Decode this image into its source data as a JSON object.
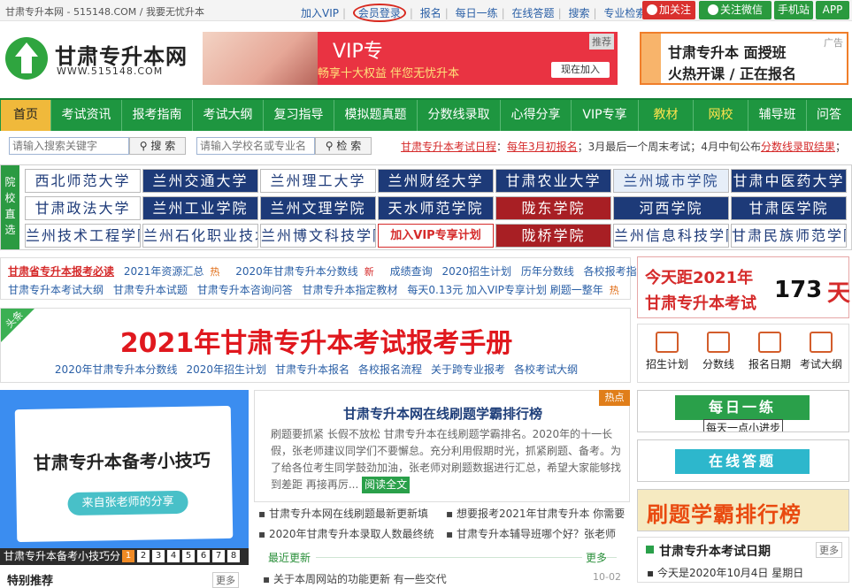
{
  "topbar": {
    "site": "甘肃专升本网 - 515148.COM / 我要无忧升本",
    "links": [
      "加入VIP",
      "会员登录",
      "报名",
      "每日一练",
      "在线答题",
      "搜索",
      "专业检索"
    ],
    "weibo": "加关注",
    "wechat": "关注微信",
    "mobile": "手机站",
    "app": "APP"
  },
  "logo": {
    "title": "甘肃专升本网",
    "url": "WWW.515148.COM"
  },
  "vip_banner": {
    "title": "VIP专",
    "subtitle": "畅享十大权益 伴您无忧升本",
    "tag": "推荐",
    "button": "现在加入"
  },
  "ad_right": {
    "line1": "甘肃专升本 面授班",
    "line2": "火热开课 / 正在报名",
    "tag": "广告"
  },
  "nav": [
    "首页",
    "考试资讯",
    "报考指南",
    "考试大纲",
    "复习指导",
    "模拟题真题",
    "分数线录取",
    "心得分享",
    "VIP专享",
    "教材",
    "网校",
    "辅导班",
    "问答"
  ],
  "search": {
    "keyword_placeholder": "请输入搜索关键字",
    "keyword_button": "搜 索",
    "school_placeholder": "请输入学校名或专业名",
    "school_button": "检 索"
  },
  "exam_info": {
    "schedule_link": "甘肃专升本考试日程",
    "sep": "：",
    "date_link": "每年3月初报名",
    "middle": "；3月最后一个周末考试；4月中旬公布",
    "result_link": "分数线录取结果",
    "end": "；"
  },
  "schools": {
    "side_label": "院校直选",
    "items": [
      "西北师范大学",
      "兰州交通大学",
      "兰州理工大学",
      "兰州财经大学",
      "甘肃农业大学",
      "兰州城市学院",
      "甘肃中医药大学",
      "甘肃政法大学",
      "兰州工业学院",
      "兰州文理学院",
      "天水师范学院",
      "陇东学院",
      "河西学院",
      "甘肃医学院",
      "兰州技术工程学院",
      "兰州石化职业技术大学",
      "兰州博文科技学院",
      "加入VIP专享计划",
      "陇桥学院",
      "兰州信息科技学院",
      "甘肃民族师范学院"
    ]
  },
  "links": {
    "row1": [
      "甘肃省专升本报考必读",
      "2021年资源汇总",
      "热",
      "2020年甘肃专升本分数线",
      "新",
      "成绩查询",
      "2020招生计划",
      "历年分数线",
      "各校报考指南"
    ],
    "row2": [
      "甘肃专升本考试大纲",
      "甘肃专升本试题",
      "甘肃专升本咨询问答",
      "甘肃专升本指定教材",
      "每天0.13元 加入VIP专享计划 刷题一整年",
      "热"
    ]
  },
  "countdown": {
    "line1": "今天距2021年",
    "line2": "甘肃专升本考试",
    "days": "173",
    "unit": "天"
  },
  "headline": {
    "corner": "头条",
    "title": "2021年甘肃专升本考试报考手册",
    "links": [
      "2020年甘肃专升本分数线",
      "2020年招生计划",
      "甘肃专升本报名",
      "各校报名流程",
      "关于跨专业报考",
      "各校考试大纲"
    ]
  },
  "tools": [
    "招生计划",
    "分数线",
    "报名日期",
    "考试大纲"
  ],
  "tip_image": {
    "title": "甘肃专升本备考小技巧",
    "subtitle": "来自张老师的分享",
    "caption": "甘肃专升本备考小技巧分",
    "pages": [
      "1",
      "2",
      "3",
      "4",
      "5",
      "6",
      "7",
      "8"
    ]
  },
  "special": {
    "title": "特别推荐",
    "more": "更多"
  },
  "article": {
    "hot": "热点",
    "title": "甘肃专升本网在线刷题学霸排行榜",
    "body": "刷题要抓紧 长假不放松 甘肃专升本在线刷题学霸排名。2020年的十一长假，张老师建议同学们不要懈怠。充分利用假期时光，抓紧刷题、备考。为了给各位考生同学鼓劲加油，张老师对刷题数据进行汇总，希望大家能够找到差距 再接再厉...",
    "read": "阅读全文"
  },
  "news": [
    "甘肃专升本网在线刷题最新更新填",
    "想要报考2021年甘肃专升本 你需要",
    "2020年甘肃专升本录取人数最终统",
    "甘肃专升本辅导班哪个好？张老师"
  ],
  "latest": {
    "title": "最近更新",
    "more": "更多",
    "item": "关于本周网站的功能更新 有一些交代",
    "date": "10-02"
  },
  "promos": {
    "daily": "每日一练",
    "daily_sub": "每天一点小进步",
    "online": "在线答题",
    "rank": "刷题学霸排行榜"
  },
  "exam_date": {
    "title": "甘肃专升本考试日期",
    "more": "更多",
    "today": "今天是2020年10月4日 星期日"
  }
}
